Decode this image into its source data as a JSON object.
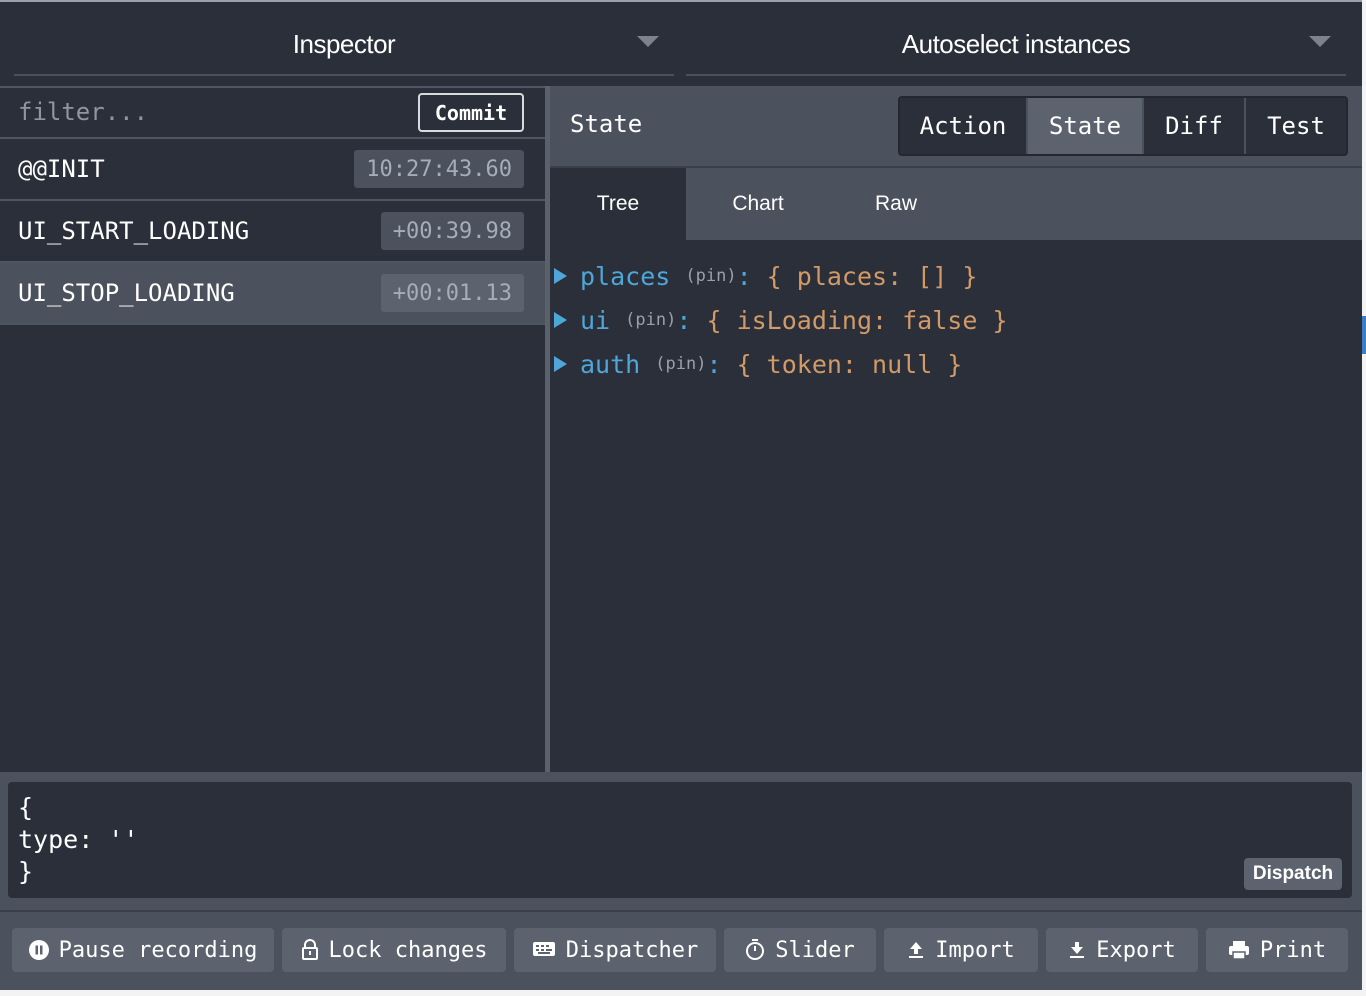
{
  "header": {
    "left_select": "Inspector",
    "right_select": "Autoselect instances"
  },
  "actions_panel": {
    "filter_placeholder": "filter...",
    "commit_label": "Commit",
    "items": [
      {
        "name": "@@INIT",
        "time": "10:27:43.60"
      },
      {
        "name": "UI_START_LOADING",
        "time": "+00:39.98"
      },
      {
        "name": "UI_STOP_LOADING",
        "time": "+00:01.13"
      }
    ]
  },
  "inspector": {
    "title": "State",
    "segments": [
      "Action",
      "State",
      "Diff",
      "Test"
    ],
    "active_segment": "State",
    "tabs": [
      "Tree",
      "Chart",
      "Raw"
    ],
    "active_tab": "Tree",
    "tree": [
      {
        "key": "places",
        "pin": "(pin)",
        "value": "{ places: [] }"
      },
      {
        "key": "ui",
        "pin": "(pin)",
        "value": "{ isLoading: false }"
      },
      {
        "key": "auth",
        "pin": "(pin)",
        "value": "{ token: null }"
      }
    ]
  },
  "dispatcher": {
    "code_line1": "{",
    "code_line2": "type: ''",
    "code_line3": "}",
    "dispatch_label": "Dispatch"
  },
  "toolbar": {
    "pause": "Pause recording",
    "lock": "Lock changes",
    "dispatcher": "Dispatcher",
    "slider": "Slider",
    "import": "Import",
    "export": "Export",
    "print": "Print"
  },
  "icons": {
    "pause": "pause-circle-icon",
    "lock": "lock-icon",
    "dispatcher": "keyboard-icon",
    "slider": "stopwatch-icon",
    "import": "upload-icon",
    "export": "download-icon",
    "print": "printer-icon"
  },
  "colors": {
    "background": "#2a2f3a",
    "panel": "#4b525d",
    "key": "#4fa6d8",
    "value": "#d19a66"
  }
}
